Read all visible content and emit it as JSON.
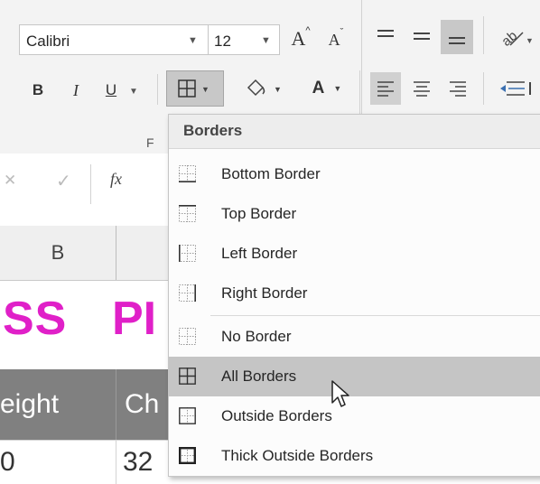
{
  "ribbon": {
    "font_name": "Calibri",
    "font_size": "12",
    "grow_font_label": "A",
    "shrink_font_label": "A",
    "bold_label": "B",
    "italic_label": "I",
    "underline_label": "U",
    "font_color_label": "A",
    "font_group_label": "F"
  },
  "formula_bar": {
    "cancel_label": "✕",
    "enter_label": "✓",
    "fx_label": "fx"
  },
  "grid": {
    "col_b_header": "B",
    "title_fragment_left": "SS",
    "title_fragment_right": "PI",
    "header_cell_left": "eight",
    "header_cell_right": "Ch",
    "value_left": "0",
    "value_right": "32",
    "title_color": "#e020c8",
    "header_row_bg": "#808080"
  },
  "borders_menu": {
    "title": "Borders",
    "items": [
      {
        "label": "Bottom Border",
        "icon": "bottom-border-icon"
      },
      {
        "label": "Top Border",
        "icon": "top-border-icon"
      },
      {
        "label": "Left Border",
        "icon": "left-border-icon"
      },
      {
        "label": "Right Border",
        "icon": "right-border-icon"
      },
      {
        "label": "No Border",
        "icon": "no-border-icon"
      },
      {
        "label": "All Borders",
        "icon": "all-borders-icon",
        "highlighted": true
      },
      {
        "label": "Outside Borders",
        "icon": "outside-borders-icon"
      },
      {
        "label": "Thick Outside Borders",
        "icon": "thick-outside-borders-icon"
      }
    ]
  }
}
